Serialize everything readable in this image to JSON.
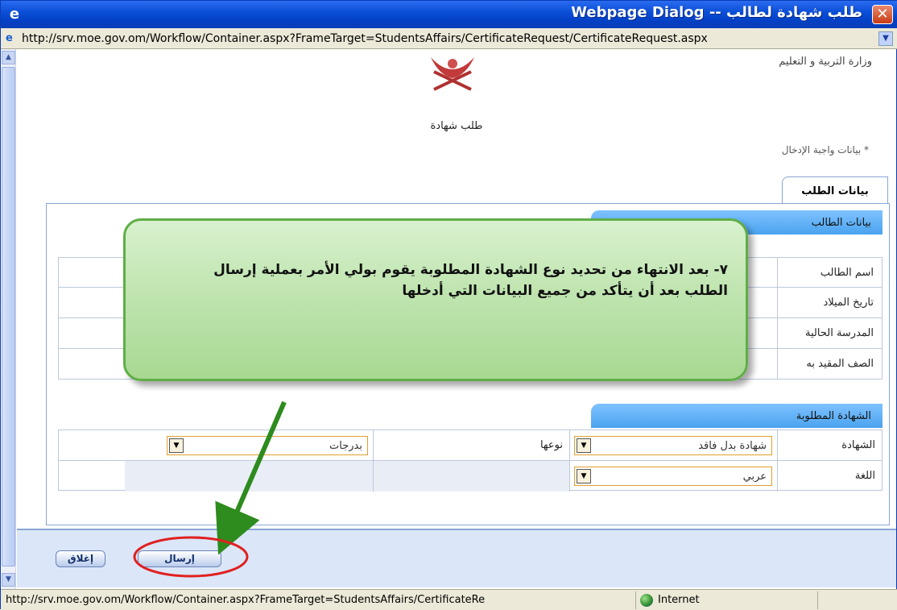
{
  "window": {
    "title": "طلب شهادة لطالب -- Webpage Dialog",
    "app_icon": "e",
    "close_symbol": "✕"
  },
  "address": {
    "url": "http://srv.moe.gov.om/Workflow/Container.aspx?FrameTarget=StudentsAffairs/CertificateRequest/CertificateRequest.aspx"
  },
  "header": {
    "ministry": "وزارة التربية و التعليم",
    "page_title": "طلب شهادة",
    "required_note": "* بيانات واجبة الإدخال"
  },
  "tabs": [
    {
      "label": "بيانات الطلب"
    }
  ],
  "student_section": {
    "header": "بيانات الطالب",
    "rows": [
      {
        "label": "اسم الطالب"
      },
      {
        "label": "تاريخ الميلاد"
      },
      {
        "label": "المدرسة الحالية"
      },
      {
        "label": "الصف المقيد به"
      }
    ]
  },
  "certificate_section": {
    "header": "الشهادة المطلوبة",
    "certificate_label": "الشهادة",
    "certificate_value": "شهادة بدل فاقد",
    "type_label": "نوعها",
    "type_value": "بدرجات",
    "language_label": "اللغة",
    "language_value": "عربي"
  },
  "buttons": {
    "send": "إرسال",
    "close": "إغلاق"
  },
  "annotation": {
    "text": "٧- بعد الانتهاء من تحديد نوع الشهادة المطلوبة يقوم بولي الأمر بعملية إرسال الطلب بعد أن يتأكد من جميع البيانات التي أدخلها"
  },
  "statusbar": {
    "url": "http://srv.moe.gov.om/Workflow/Container.aspx?FrameTarget=StudentsAffairs/CertificateRe",
    "zone": "Internet"
  },
  "colors": {
    "titlebar": "#0b4fd8",
    "section_header": "#4aa3ef",
    "callout_bg": "#c2e6b3",
    "callout_border": "#5fae46",
    "arrow": "#2e8b1e",
    "highlight_circle": "#e02020"
  },
  "icons": {
    "dropdown": "chevron-down-icon",
    "scroll_up": "arrow-up-icon",
    "scroll_down": "arrow-down-icon",
    "zone": "globe-icon"
  }
}
